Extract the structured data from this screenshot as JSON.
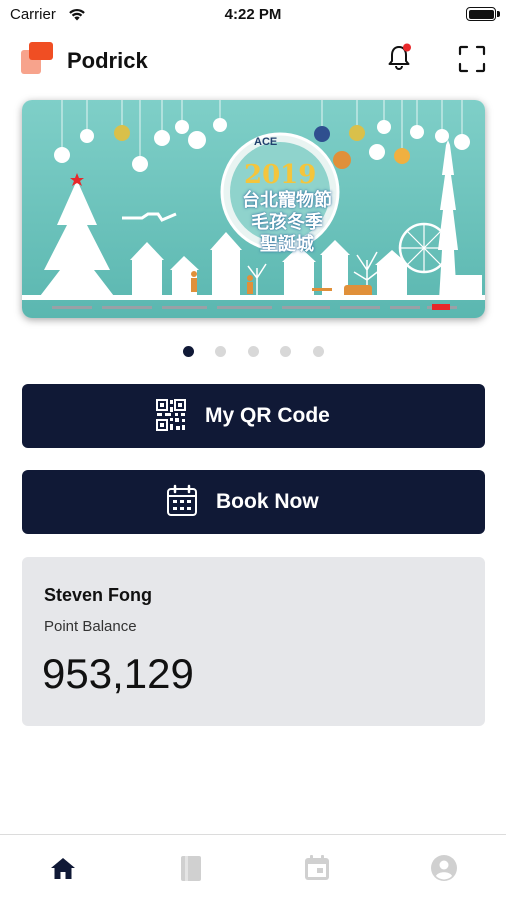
{
  "status_bar": {
    "carrier": "Carrier",
    "time": "4:22 PM"
  },
  "header": {
    "app_name": "Podrick",
    "brand_color": "#f04e23"
  },
  "banner": {
    "brand_text": "ACE",
    "year": "2019",
    "line1": "台北寵物節",
    "line2": "毛孩冬季",
    "line3": "聖誕城",
    "current_slide": 1,
    "slide_count": 5
  },
  "actions": {
    "qr_label": "My QR Code",
    "book_label": "Book Now"
  },
  "points": {
    "member_name": "Steven Fong",
    "balance_label": "Point Balance",
    "balance_value": "953,129"
  },
  "tabbar": {
    "tabs": [
      {
        "icon": "home-icon",
        "active": true
      },
      {
        "icon": "book-icon",
        "active": false
      },
      {
        "icon": "calendar-icon",
        "active": false
      },
      {
        "icon": "profile-icon",
        "active": false
      }
    ]
  },
  "colors": {
    "button_bg": "#101936",
    "card_bg": "#e6e7ea",
    "notification_dot": "#e8282b",
    "tab_active": "#101936",
    "tab_inactive": "#d0d0d0"
  }
}
